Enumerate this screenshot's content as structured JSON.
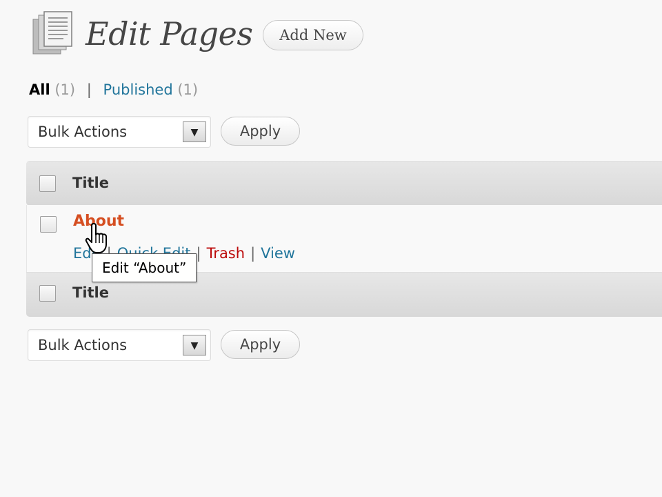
{
  "header": {
    "title": "Edit Pages",
    "add_new_label": "Add New",
    "page_icon": "pages-icon"
  },
  "filters": {
    "all_label": "All",
    "all_count": "(1)",
    "separator": "|",
    "published_label": "Published",
    "published_count": "(1)"
  },
  "bulk_top": {
    "select_value": "Bulk Actions",
    "apply_label": "Apply"
  },
  "bulk_bottom": {
    "select_value": "Bulk Actions",
    "apply_label": "Apply"
  },
  "table": {
    "header_title": "Title",
    "footer_title": "Title",
    "rows": [
      {
        "title": "About",
        "actions": {
          "edit": "Edit",
          "quick_edit": "Quick Edit",
          "trash": "Trash",
          "view": "View",
          "separator": "|"
        }
      }
    ]
  },
  "tooltip": {
    "text": "Edit “About”"
  },
  "colors": {
    "link": "#21759b",
    "row_title": "#d54e21",
    "trash": "#bc0b0b",
    "background": "#f8f8f8"
  }
}
